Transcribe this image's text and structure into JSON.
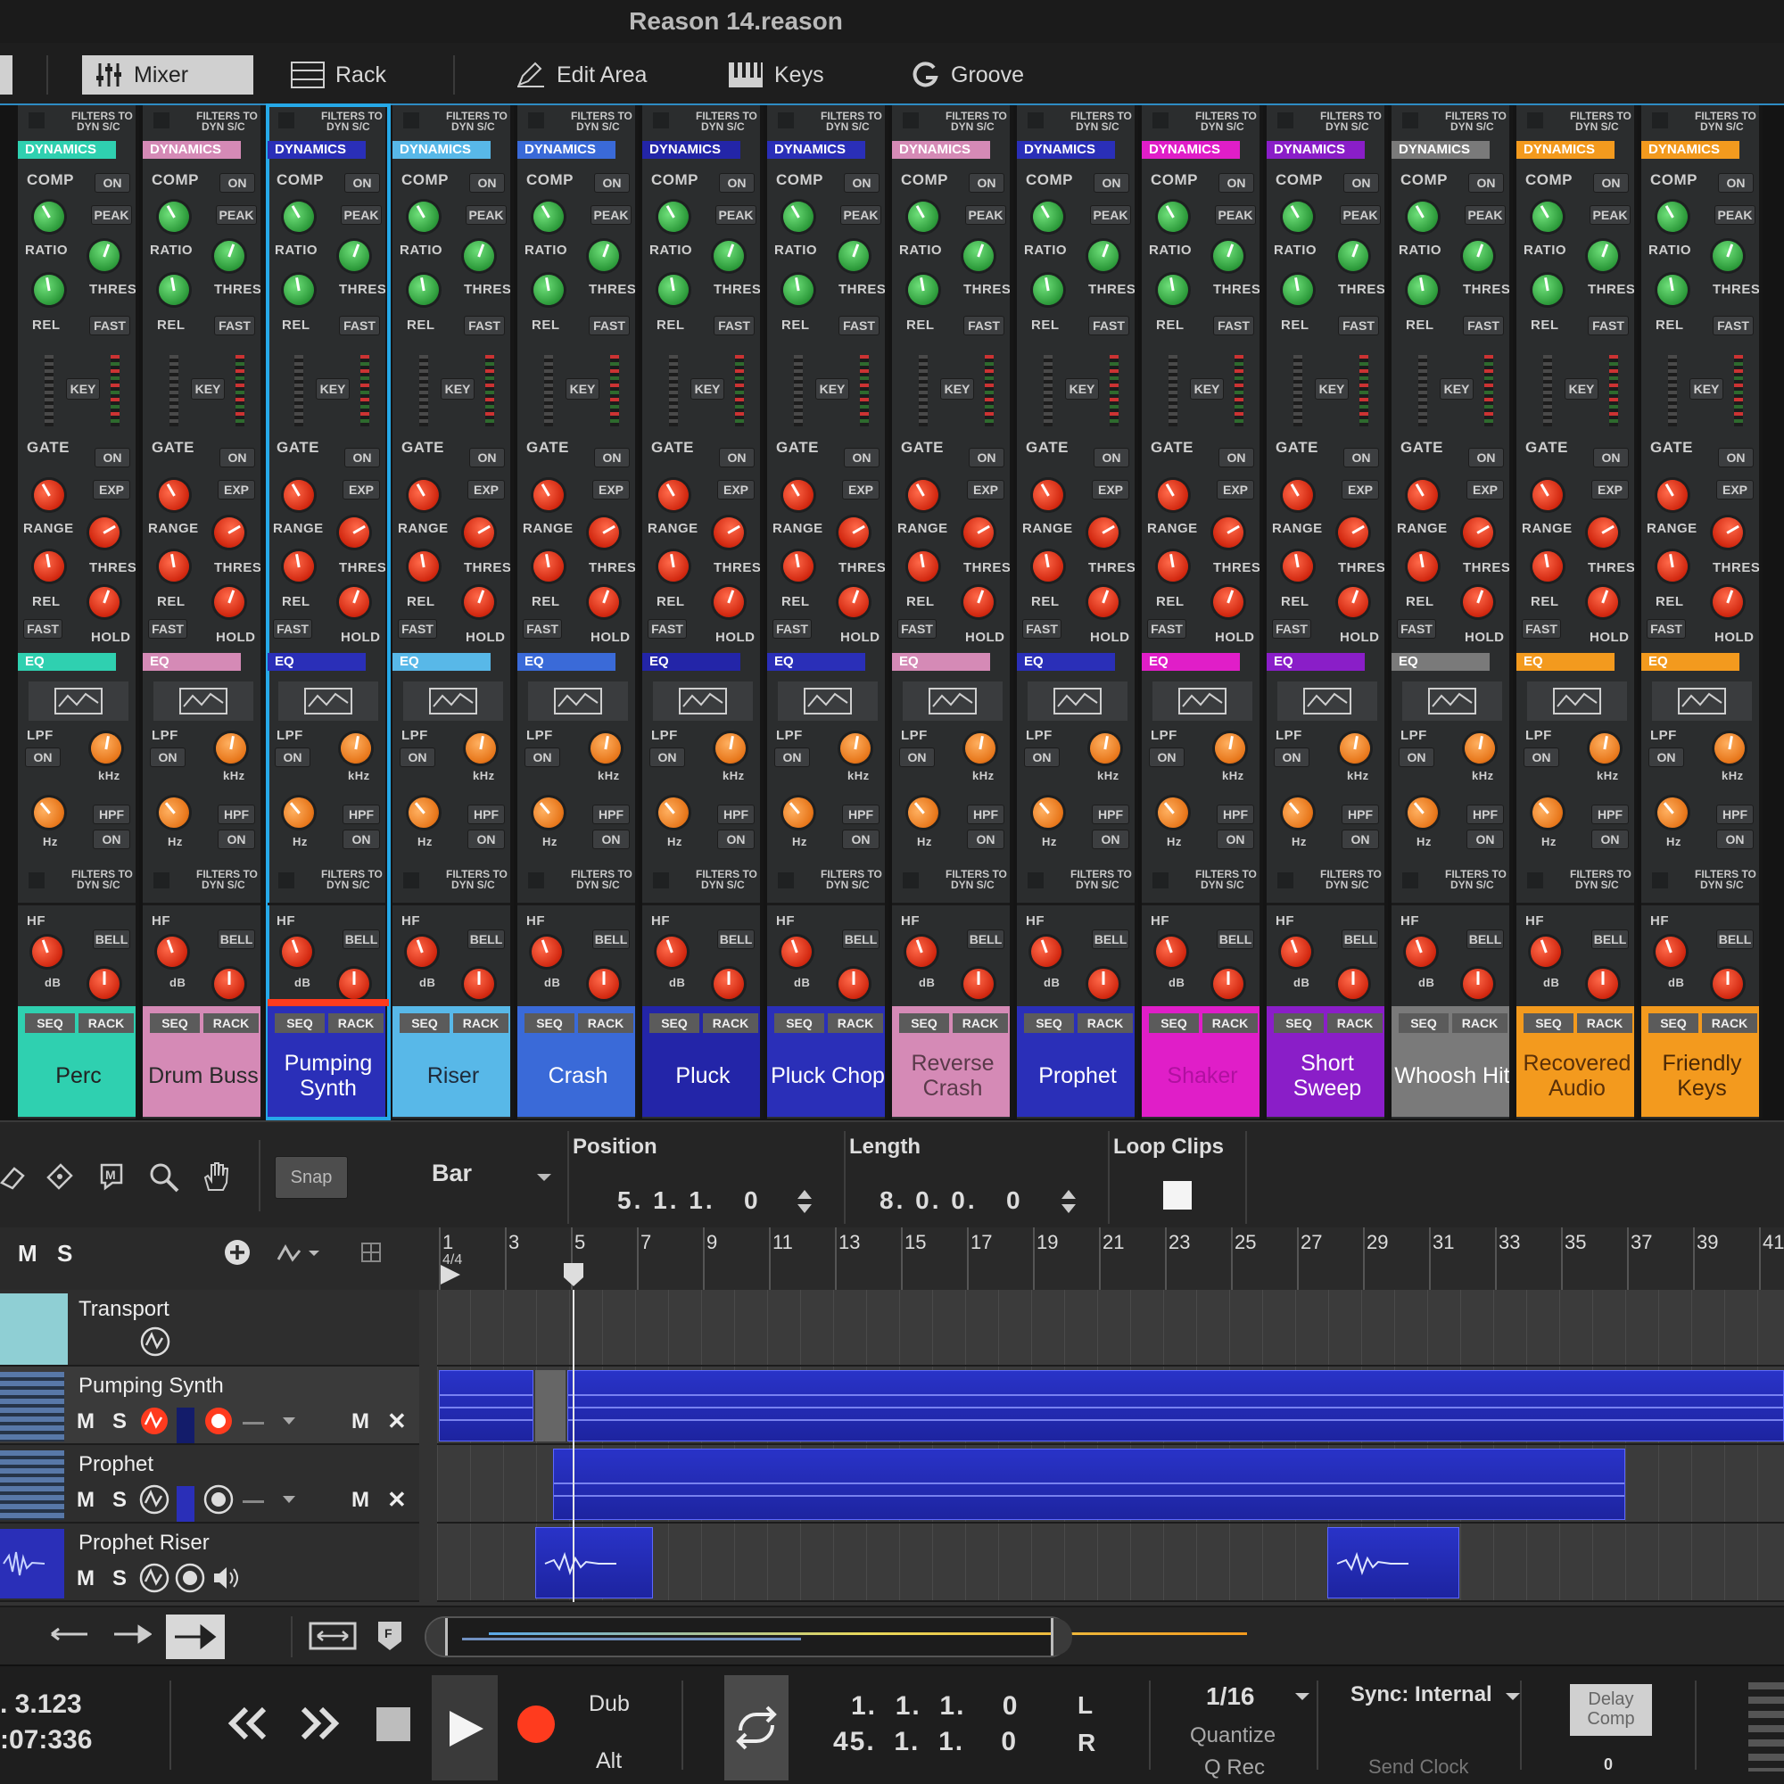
{
  "window": {
    "title": "Reason 14.reason"
  },
  "toolbar": {
    "mixer": "Mixer",
    "rack": "Rack",
    "edit_area": "Edit Area",
    "keys": "Keys",
    "groove": "Groove"
  },
  "strip_labels": {
    "filters_to_dyn_sc_1": "FILTERS TO",
    "filters_to_dyn_sc_2": "DYN S/C",
    "dynamics": "DYNAMICS",
    "comp": "COMP",
    "on": "ON",
    "peak": "PEAK",
    "ratio": "RATIO",
    "thres": "THRES",
    "rel": "REL",
    "fast": "FAST",
    "key": "KEY",
    "gate": "GATE",
    "exp": "EXP",
    "range": "RANGE",
    "hold": "HOLD",
    "eq": "EQ",
    "lpf": "LPF",
    "hpf": "HPF",
    "khz": "kHz",
    "hz": "Hz",
    "hf": "HF",
    "bell": "BELL",
    "db": "dB",
    "seq": "SEQ",
    "rack": "RACK"
  },
  "channels": [
    {
      "name": "Perc",
      "color": "#2fd0b0",
      "text_color": "#222222"
    },
    {
      "name": "Drum Buss",
      "color": "#d58ab6",
      "text_color": "#2a2a2a"
    },
    {
      "name": "Pumping Synth",
      "color": "#2a2fb8",
      "text_color": "#ffffff"
    },
    {
      "name": "Riser",
      "color": "#58b8e8",
      "text_color": "#1e2a3a"
    },
    {
      "name": "Crash",
      "color": "#3a6ad8",
      "text_color": "#ffffff"
    },
    {
      "name": "Pluck",
      "color": "#2325a8",
      "text_color": "#ffffff"
    },
    {
      "name": "Pluck Chop",
      "color": "#2a2fb8",
      "text_color": "#ffffff"
    },
    {
      "name": "Reverse Crash",
      "color": "#d58ab6",
      "text_color": "#5a3a4a"
    },
    {
      "name": "Prophet",
      "color": "#2a2fb8",
      "text_color": "#ffffff"
    },
    {
      "name": "Shaker",
      "color": "#e01ec8",
      "text_color": "#b010a0"
    },
    {
      "name": "Short Sweep",
      "color": "#8a1ec8",
      "text_color": "#ffffff"
    },
    {
      "name": "Whoosh Hit",
      "color": "#7a7a7a",
      "text_color": "#ffffff"
    },
    {
      "name": "Recovered Audio",
      "color": "#f39a1e",
      "text_color": "#5a3008"
    },
    {
      "name": "Friendly Keys",
      "color": "#f39a1e",
      "text_color": "#4a2806"
    }
  ],
  "seq_toolbar": {
    "snap": "Snap",
    "bar": "Bar",
    "position_label": "Position",
    "position_value": "5. 1. 1.   0",
    "length_label": "Length",
    "length_value": "8. 0. 0.   0",
    "loop_clips": "Loop Clips"
  },
  "ruler": {
    "mute": "M",
    "solo": "S",
    "bars": [
      "1",
      "3",
      "5",
      "7",
      "9",
      "11",
      "13",
      "15",
      "17",
      "19",
      "21",
      "23",
      "25",
      "27",
      "29",
      "31",
      "33",
      "35",
      "37",
      "39",
      "41"
    ],
    "time_signature": "4/4"
  },
  "tracks": [
    {
      "name": "Transport"
    },
    {
      "name": "Pumping Synth",
      "m": "M",
      "s": "S",
      "m2": "M",
      "x": "✕"
    },
    {
      "name": "Prophet",
      "m": "M",
      "s": "S",
      "m2": "M",
      "x": "✕"
    },
    {
      "name": "Prophet Riser",
      "m": "M",
      "s": "S"
    }
  ],
  "transport": {
    "tempo": ". 3.123",
    "time": ":07:336",
    "dub": "Dub",
    "alt": "Alt",
    "loop_left": "1.  1.  1.    0",
    "loop_right": "45.  1.  1.    0",
    "l": "L",
    "r": "R",
    "quantize_value": "1/16",
    "quantize": "Quantize",
    "q_rec": "Q Rec",
    "sync": "Sync: Internal",
    "send_clock": "Send Clock",
    "delay_comp": "Delay\nComp",
    "delay_value": "0"
  },
  "colors": {
    "selection": "#26a9e8",
    "record": "#ff3b1e",
    "clip": "#2933c8"
  }
}
